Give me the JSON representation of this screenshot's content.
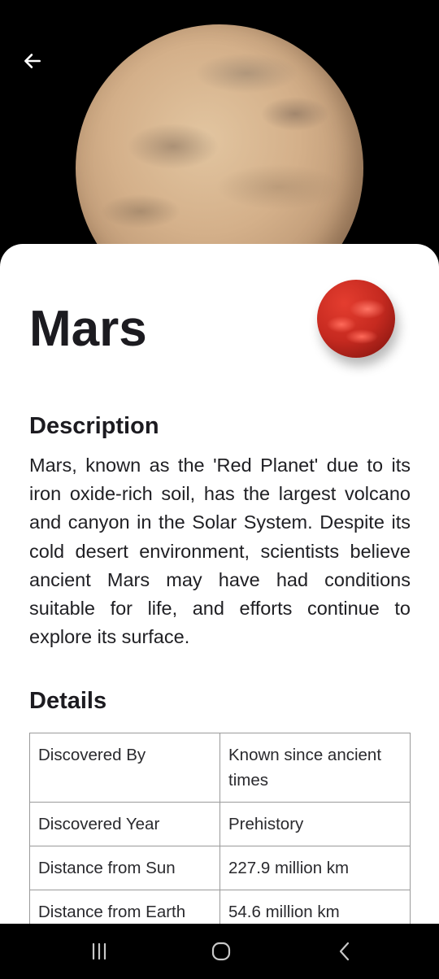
{
  "planet": {
    "name": "Mars",
    "description": "Mars, known as the 'Red Planet' due to its iron oxide-rich soil, has the largest volcano and canyon in the Solar System. Despite its cold desert environment, scientists believe ancient Mars may have had conditions suitable for life, and efforts continue to explore its surface."
  },
  "sections": {
    "description_heading": "Description",
    "details_heading": "Details"
  },
  "details": [
    {
      "label": "Discovered By",
      "value": "Known since ancient times"
    },
    {
      "label": "Discovered Year",
      "value": "Prehistory"
    },
    {
      "label": "Distance from Sun",
      "value": "227.9 million km"
    },
    {
      "label": "Distance from Earth",
      "value": "54.6 million km"
    }
  ],
  "icons": {
    "back": "arrow-left-icon",
    "nav_recents": "recents-icon",
    "nav_home": "home-icon",
    "nav_back": "chevron-left-icon"
  },
  "colors": {
    "sheet_bg": "#ffffff",
    "text": "#1c1b20",
    "planet_red": "#c62a20"
  }
}
